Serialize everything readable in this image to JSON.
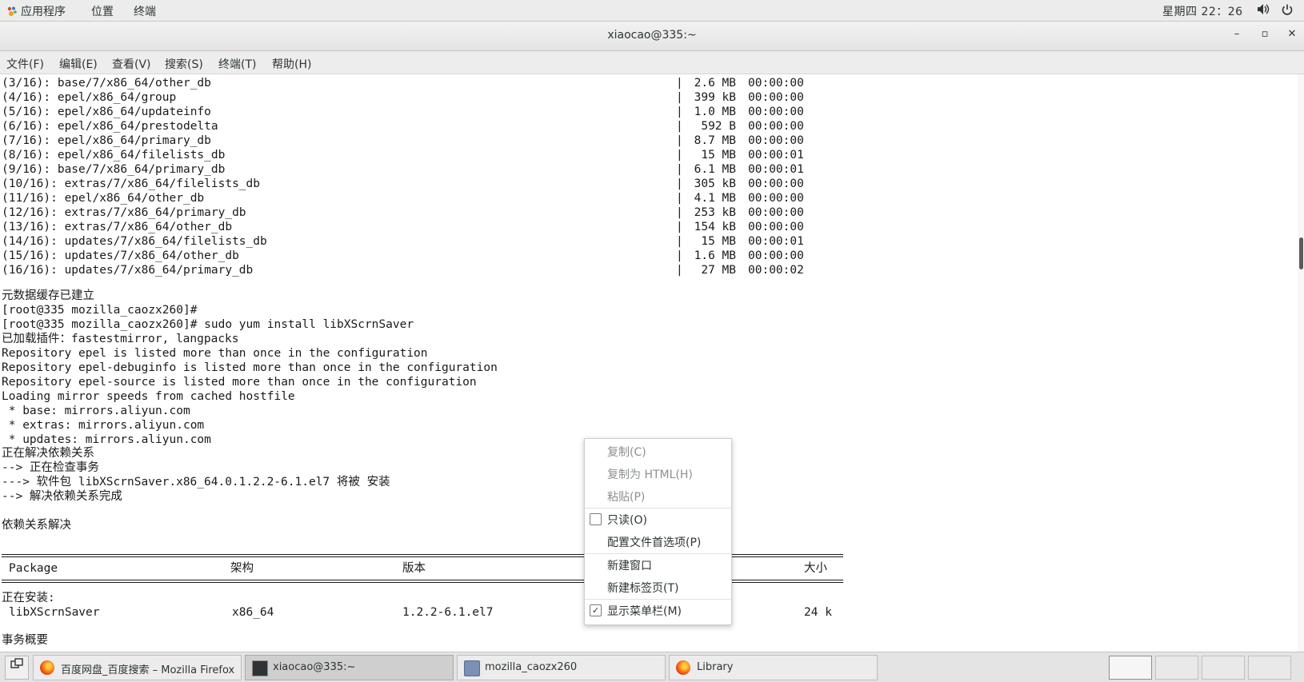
{
  "top_panel": {
    "apps_label": "应用程序",
    "places_label": "位置",
    "terminal_label": "终端",
    "clock": "星期四 22：26",
    "volume_icon": "volume-icon",
    "power_icon": "power-icon"
  },
  "window": {
    "title": "xiaocao@335:~",
    "minimize_glyph": "–",
    "maximize_glyph": "▫",
    "close_glyph": "✕"
  },
  "menubar": {
    "file": "文件(F)",
    "edit": "编辑(E)",
    "view": "查看(V)",
    "search": "搜索(S)",
    "terminal": "终端(T)",
    "help": "帮助(H)"
  },
  "terminal": {
    "repo_rows": [
      {
        "name": "(3/16): base/7/x86_64/other_db",
        "size": "2.6 MB",
        "time": "00:00:00"
      },
      {
        "name": "(4/16): epel/x86_64/group",
        "size": "399 kB",
        "time": "00:00:00"
      },
      {
        "name": "(5/16): epel/x86_64/updateinfo",
        "size": "1.0 MB",
        "time": "00:00:00"
      },
      {
        "name": "(6/16): epel/x86_64/prestodelta",
        "size": "592 B",
        "time": "00:00:00"
      },
      {
        "name": "(7/16): epel/x86_64/primary_db",
        "size": "8.7 MB",
        "time": "00:00:00"
      },
      {
        "name": "(8/16): epel/x86_64/filelists_db",
        "size": "15 MB",
        "time": "00:00:01"
      },
      {
        "name": "(9/16): base/7/x86_64/primary_db",
        "size": "6.1 MB",
        "time": "00:00:01"
      },
      {
        "name": "(10/16): extras/7/x86_64/filelists_db",
        "size": "305 kB",
        "time": "00:00:00"
      },
      {
        "name": "(11/16): epel/x86_64/other_db",
        "size": "4.1 MB",
        "time": "00:00:00"
      },
      {
        "name": "(12/16): extras/7/x86_64/primary_db",
        "size": "253 kB",
        "time": "00:00:00"
      },
      {
        "name": "(13/16): extras/7/x86_64/other_db",
        "size": "154 kB",
        "time": "00:00:00"
      },
      {
        "name": "(14/16): updates/7/x86_64/filelists_db",
        "size": "15 MB",
        "time": "00:00:01"
      },
      {
        "name": "(15/16): updates/7/x86_64/other_db",
        "size": "1.6 MB",
        "time": "00:00:00"
      },
      {
        "name": "(16/16): updates/7/x86_64/primary_db",
        "size": "27 MB",
        "time": "00:00:02"
      }
    ],
    "separator": "|",
    "lines": [
      "元数据缓存已建立",
      "[root@335 mozilla_caozx260]#",
      "[root@335 mozilla_caozx260]# sudo yum install libXScrnSaver",
      "已加载插件：fastestmirror, langpacks",
      "Repository epel is listed more than once in the configuration",
      "Repository epel-debuginfo is listed more than once in the configuration",
      "Repository epel-source is listed more than once in the configuration",
      "Loading mirror speeds from cached hostfile",
      " * base: mirrors.aliyun.com",
      " * extras: mirrors.aliyun.com",
      " * updates: mirrors.aliyun.com",
      "正在解决依赖关系",
      "--> 正在检查事务",
      "---> 软件包 libXScrnSaver.x86_64.0.1.2.2-6.1.el7 将被 安装",
      "--> 解决依赖关系完成",
      "依赖关系解决"
    ],
    "table": {
      "headers": {
        "package": "Package",
        "arch": "架构",
        "version": "版本",
        "size": "大小"
      },
      "section": "正在安装:",
      "row": {
        "package": "libXScrnSaver",
        "arch": "x86_64",
        "version": "1.2.2-6.1.el7",
        "size": "24 k"
      },
      "summary": "事务概要"
    }
  },
  "context_menu": {
    "copy": "复制(C)",
    "copy_html": "复制为 HTML(H)",
    "paste": "粘贴(P)",
    "read_only": "只读(O)",
    "read_only_checked": false,
    "profile_prefs": "配置文件首选项(P)",
    "new_window": "新建窗口",
    "new_tab": "新建标签页(T)",
    "show_menubar": "显示菜单栏(M)",
    "show_menubar_checked": true
  },
  "taskbar": {
    "tasks": [
      {
        "label": "百度网盘_百度搜索 – Mozilla Firefox",
        "icon": "firefox-icon"
      },
      {
        "label": "xiaocao@335:~",
        "icon": "terminal-icon"
      },
      {
        "label": "mozilla_caozx260",
        "icon": "file-manager-icon"
      },
      {
        "label": "Library",
        "icon": "firefox-icon"
      }
    ],
    "workspaces": 4
  }
}
